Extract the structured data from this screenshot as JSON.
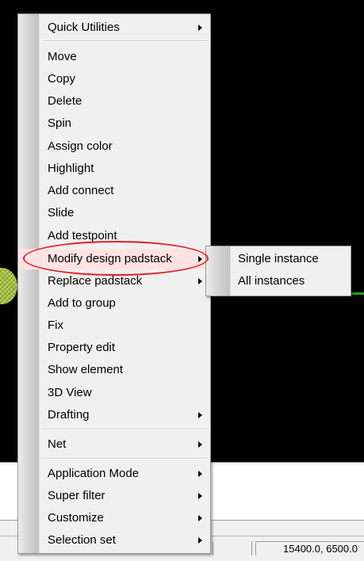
{
  "context_menu": {
    "items": [
      {
        "label": "Quick Utilities",
        "submenu": true
      },
      {
        "label": "Move",
        "submenu": false
      },
      {
        "label": "Copy",
        "submenu": false
      },
      {
        "label": "Delete",
        "submenu": false
      },
      {
        "label": "Spin",
        "submenu": false
      },
      {
        "label": "Assign color",
        "submenu": false
      },
      {
        "label": "Highlight",
        "submenu": false
      },
      {
        "label": "Add connect",
        "submenu": false
      },
      {
        "label": "Slide",
        "submenu": false
      },
      {
        "label": "Add testpoint",
        "submenu": false
      },
      {
        "label": "Modify design padstack",
        "submenu": true,
        "active": true
      },
      {
        "label": "Replace padstack",
        "submenu": true
      },
      {
        "label": "Add to group",
        "submenu": false
      },
      {
        "label": "Fix",
        "submenu": false
      },
      {
        "label": "Property edit",
        "submenu": false
      },
      {
        "label": "Show element",
        "submenu": false
      },
      {
        "label": "3D View",
        "submenu": false
      },
      {
        "label": "Drafting",
        "submenu": true
      },
      {
        "label": "Net",
        "submenu": true
      },
      {
        "label": "Application Mode",
        "submenu": true
      },
      {
        "label": "Super filter",
        "submenu": true
      },
      {
        "label": "Customize",
        "submenu": true
      },
      {
        "label": "Selection set",
        "submenu": true
      }
    ]
  },
  "submenu": {
    "items": [
      {
        "label": "Single instance"
      },
      {
        "label": "All instances"
      }
    ]
  },
  "status_bar": {
    "coordinates": "15400.0, 6500.0"
  },
  "colors": {
    "menu_background": "#f0f0f0",
    "active_item_highlight": "#ffe3e3",
    "annotation_ellipse": "#e41e26",
    "canvas_background": "#000000",
    "trace": "#1fa51f"
  }
}
